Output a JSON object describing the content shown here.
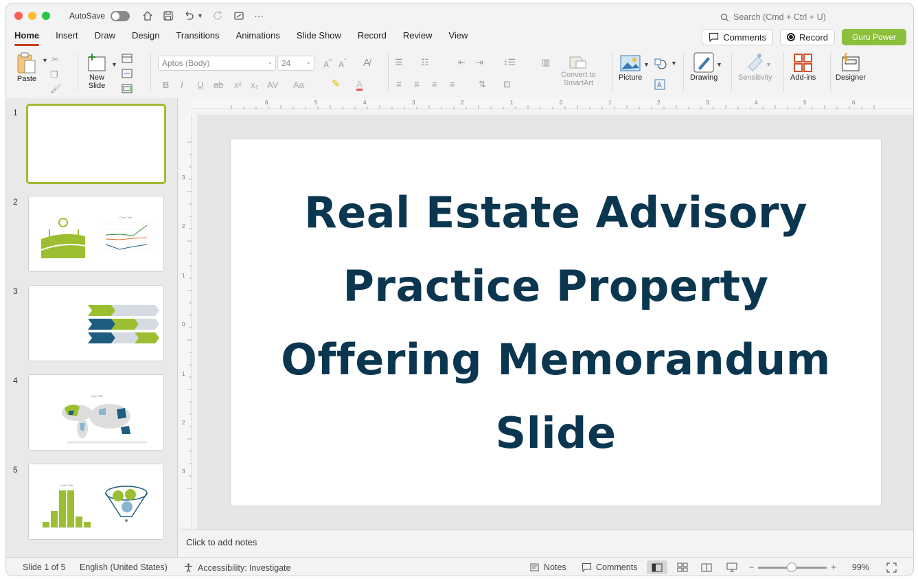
{
  "titlebar": {
    "autosave_label": "AutoSave",
    "search_placeholder": "Search (Cmd + Ctrl + U)"
  },
  "menu": {
    "tabs": [
      "Home",
      "Insert",
      "Draw",
      "Design",
      "Transitions",
      "Animations",
      "Slide Show",
      "Record",
      "Review",
      "View"
    ],
    "active_tab": "Home",
    "comments_label": "Comments",
    "record_label": "Record",
    "guru_label": "Guru Power"
  },
  "ribbon": {
    "paste": "Paste",
    "new_slide_line1": "New",
    "new_slide_line2": "Slide",
    "font_name": "Aptos (Body)",
    "font_size": "24",
    "convert_line1": "Convert to",
    "convert_line2": "SmartArt",
    "picture": "Picture",
    "drawing": "Drawing",
    "sensitivity": "Sensitivity",
    "addins": "Add-ins",
    "designer": "Designer"
  },
  "thumbnails": [
    "1",
    "2",
    "3",
    "4",
    "5"
  ],
  "slide": {
    "title": "Real Estate Advisory Practice Property Offering Memorandum Slide"
  },
  "notes": {
    "placeholder": "Click to add notes"
  },
  "status": {
    "slide_info": "Slide 1 of 5",
    "language": "English (United States)",
    "accessibility": "Accessibility: Investigate",
    "notes": "Notes",
    "comments": "Comments",
    "zoom": "99%"
  },
  "colors": {
    "accent_tab": "#c43e1c",
    "guru": "#8bbf3c",
    "title_text": "#0b3650",
    "thumb_green": "#9bbf30",
    "thumb_blue": "#1e5c80"
  }
}
